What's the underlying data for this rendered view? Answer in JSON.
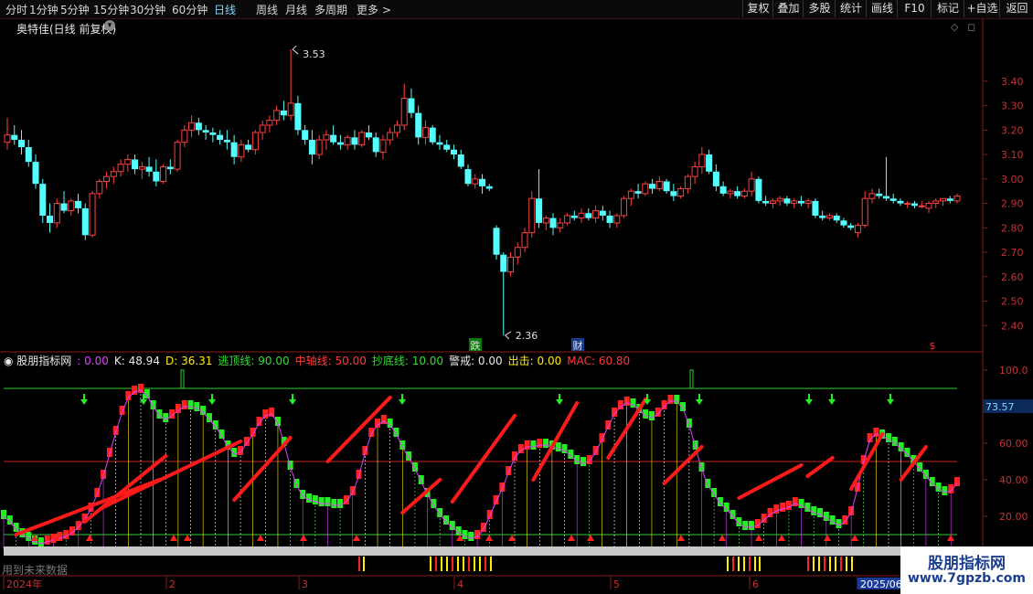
{
  "toolbar": {
    "timeframes": [
      "分时",
      "1分钟",
      "5分钟",
      "15分钟",
      "30分钟",
      "60分钟",
      "日线",
      "周线",
      "月线",
      "多周期",
      "更多 >"
    ],
    "active_timeframe": "日线",
    "right_buttons": [
      "复权",
      "叠加",
      "多股",
      "统计",
      "画线",
      "F10",
      "标记",
      "+自选",
      "返回"
    ]
  },
  "main_panel": {
    "title": "奥特佳(日线 前复权)",
    "price_axis": [
      "3.40",
      "3.30",
      "3.20",
      "3.10",
      "3.00",
      "2.90",
      "2.80",
      "2.70",
      "2.60",
      "2.50",
      "2.40"
    ],
    "high_label": "3.53",
    "low_label": "2.36",
    "markers": [
      "跌",
      "财",
      "$"
    ]
  },
  "indicator_panel": {
    "name": "股朋指标网",
    "values": [
      {
        "label": ": 0.00",
        "color": "#e040ff"
      },
      {
        "label": "K: 48.94",
        "color": "#e8e8e8"
      },
      {
        "label": "D: 36.31",
        "color": "#ffee00"
      },
      {
        "label": "逃顶线: 90.00",
        "color": "#33dd33"
      },
      {
        "label": "中轴线: 50.00",
        "color": "#ff3b3b"
      },
      {
        "label": "抄底线: 10.00",
        "color": "#33dd33"
      },
      {
        "label": "警戒: 0.00",
        "color": "#e8e8e8"
      },
      {
        "label": "出击: 0.00",
        "color": "#ffee00"
      },
      {
        "label": "MAC: 60.80",
        "color": "#ff3b3b"
      }
    ],
    "axis": [
      "100.0",
      "60.00",
      "40.00",
      "20.00"
    ],
    "current_value": "73.57",
    "footer_text": "用到未来数据"
  },
  "date_axis": [
    "2024年",
    "2",
    "3",
    "4",
    "5",
    "6",
    "2025/06"
  ],
  "watermark": {
    "line1": "股朋指标网",
    "line2": "www.7gpzb.com"
  },
  "chart_data": {
    "type": "candlestick",
    "y_range": [
      2.33,
      3.62
    ],
    "ohlc": [
      [
        3.15,
        3.25,
        3.12,
        3.18
      ],
      [
        3.18,
        3.22,
        3.14,
        3.16
      ],
      [
        3.16,
        3.2,
        3.1,
        3.13
      ],
      [
        3.13,
        3.16,
        3.05,
        3.07
      ],
      [
        3.07,
        3.1,
        2.96,
        2.98
      ],
      [
        2.98,
        3.0,
        2.82,
        2.85
      ],
      [
        2.85,
        2.9,
        2.78,
        2.82
      ],
      [
        2.82,
        2.92,
        2.8,
        2.9
      ],
      [
        2.9,
        2.95,
        2.86,
        2.87
      ],
      [
        2.87,
        2.92,
        2.85,
        2.91
      ],
      [
        2.91,
        2.94,
        2.86,
        2.88
      ],
      [
        2.88,
        2.9,
        2.75,
        2.77
      ],
      [
        2.77,
        2.95,
        2.76,
        2.94
      ],
      [
        2.94,
        3.0,
        2.92,
        2.99
      ],
      [
        2.99,
        3.03,
        2.96,
        3.01
      ],
      [
        3.01,
        3.05,
        2.98,
        3.03
      ],
      [
        3.03,
        3.08,
        3.01,
        3.06
      ],
      [
        3.06,
        3.1,
        3.03,
        3.08
      ],
      [
        3.08,
        3.1,
        3.02,
        3.04
      ],
      [
        3.04,
        3.07,
        3.0,
        3.05
      ],
      [
        3.05,
        3.09,
        3.01,
        3.03
      ],
      [
        3.03,
        3.08,
        2.97,
        2.99
      ],
      [
        2.99,
        3.06,
        2.98,
        3.05
      ],
      [
        3.05,
        3.08,
        3.02,
        3.04
      ],
      [
        3.04,
        3.16,
        3.03,
        3.15
      ],
      [
        3.15,
        3.22,
        3.13,
        3.2
      ],
      [
        3.2,
        3.26,
        3.17,
        3.23
      ],
      [
        3.23,
        3.25,
        3.18,
        3.2
      ],
      [
        3.2,
        3.22,
        3.16,
        3.19
      ],
      [
        3.19,
        3.21,
        3.15,
        3.18
      ],
      [
        3.18,
        3.2,
        3.14,
        3.16
      ],
      [
        3.16,
        3.2,
        3.12,
        3.15
      ],
      [
        3.15,
        3.18,
        3.06,
        3.09
      ],
      [
        3.09,
        3.16,
        3.07,
        3.14
      ],
      [
        3.14,
        3.16,
        3.11,
        3.12
      ],
      [
        3.12,
        3.2,
        3.1,
        3.19
      ],
      [
        3.19,
        3.24,
        3.16,
        3.22
      ],
      [
        3.22,
        3.26,
        3.19,
        3.24
      ],
      [
        3.24,
        3.3,
        3.22,
        3.28
      ],
      [
        3.28,
        3.32,
        3.24,
        3.26
      ],
      [
        3.26,
        3.53,
        3.24,
        3.31
      ],
      [
        3.31,
        3.34,
        3.18,
        3.2
      ],
      [
        3.2,
        3.22,
        3.14,
        3.16
      ],
      [
        3.16,
        3.2,
        3.06,
        3.1
      ],
      [
        3.1,
        3.18,
        3.08,
        3.16
      ],
      [
        3.16,
        3.2,
        3.12,
        3.18
      ],
      [
        3.18,
        3.22,
        3.14,
        3.15
      ],
      [
        3.15,
        3.18,
        3.12,
        3.14
      ],
      [
        3.14,
        3.18,
        3.12,
        3.17
      ],
      [
        3.17,
        3.2,
        3.12,
        3.14
      ],
      [
        3.14,
        3.2,
        3.13,
        3.19
      ],
      [
        3.19,
        3.22,
        3.16,
        3.17
      ],
      [
        3.17,
        3.19,
        3.09,
        3.11
      ],
      [
        3.11,
        3.18,
        3.08,
        3.16
      ],
      [
        3.16,
        3.21,
        3.14,
        3.19
      ],
      [
        3.19,
        3.24,
        3.17,
        3.22
      ],
      [
        3.22,
        3.39,
        3.2,
        3.33
      ],
      [
        3.33,
        3.37,
        3.25,
        3.27
      ],
      [
        3.27,
        3.3,
        3.14,
        3.17
      ],
      [
        3.17,
        3.24,
        3.14,
        3.21
      ],
      [
        3.21,
        3.22,
        3.14,
        3.15
      ],
      [
        3.15,
        3.18,
        3.12,
        3.14
      ],
      [
        3.14,
        3.16,
        3.11,
        3.12
      ],
      [
        3.12,
        3.14,
        3.08,
        3.1
      ],
      [
        3.1,
        3.12,
        3.04,
        3.05
      ],
      [
        3.04,
        3.06,
        2.97,
        2.98
      ],
      [
        2.98,
        3.02,
        2.96,
        3.0
      ],
      [
        3.0,
        3.02,
        2.94,
        2.97
      ],
      [
        2.97,
        2.98,
        2.95,
        2.96
      ],
      [
        2.8,
        2.81,
        2.67,
        2.69
      ],
      [
        2.69,
        2.7,
        2.36,
        2.62
      ],
      [
        2.62,
        2.7,
        2.6,
        2.68
      ],
      [
        2.68,
        2.74,
        2.65,
        2.72
      ],
      [
        2.72,
        2.8,
        2.7,
        2.78
      ],
      [
        2.78,
        2.95,
        2.76,
        2.92
      ],
      [
        2.92,
        3.04,
        2.8,
        2.82
      ],
      [
        2.82,
        2.85,
        2.79,
        2.84
      ],
      [
        2.84,
        2.86,
        2.77,
        2.8
      ],
      [
        2.8,
        2.84,
        2.78,
        2.82
      ],
      [
        2.82,
        2.86,
        2.81,
        2.85
      ],
      [
        2.85,
        2.87,
        2.83,
        2.84
      ],
      [
        2.84,
        2.88,
        2.82,
        2.86
      ],
      [
        2.86,
        2.88,
        2.83,
        2.84
      ],
      [
        2.84,
        2.89,
        2.82,
        2.87
      ],
      [
        2.87,
        2.89,
        2.83,
        2.85
      ],
      [
        2.85,
        2.87,
        2.8,
        2.82
      ],
      [
        2.82,
        2.86,
        2.8,
        2.85
      ],
      [
        2.85,
        2.93,
        2.84,
        2.92
      ],
      [
        2.92,
        2.96,
        2.89,
        2.95
      ],
      [
        2.95,
        2.98,
        2.92,
        2.94
      ],
      [
        2.94,
        2.99,
        2.93,
        2.98
      ],
      [
        2.98,
        3.0,
        2.94,
        2.96
      ],
      [
        2.96,
        3.01,
        2.95,
        2.99
      ],
      [
        2.99,
        3.0,
        2.94,
        2.95
      ],
      [
        2.95,
        2.98,
        2.91,
        2.93
      ],
      [
        2.93,
        2.97,
        2.92,
        2.96
      ],
      [
        2.96,
        3.02,
        2.94,
        3.01
      ],
      [
        3.01,
        3.07,
        2.98,
        3.05
      ],
      [
        3.05,
        3.13,
        3.02,
        3.1
      ],
      [
        3.1,
        3.12,
        3.02,
        3.03
      ],
      [
        3.03,
        3.06,
        2.95,
        2.97
      ],
      [
        2.97,
        2.99,
        2.93,
        2.94
      ],
      [
        2.94,
        2.96,
        2.92,
        2.95
      ],
      [
        2.95,
        2.97,
        2.92,
        2.93
      ],
      [
        2.93,
        2.96,
        2.92,
        2.95
      ],
      [
        2.95,
        3.03,
        2.93,
        3.0
      ],
      [
        3.0,
        3.01,
        2.9,
        2.91
      ],
      [
        2.91,
        2.93,
        2.89,
        2.9
      ],
      [
        2.9,
        2.92,
        2.88,
        2.91
      ],
      [
        2.91,
        2.93,
        2.89,
        2.92
      ],
      [
        2.92,
        2.93,
        2.89,
        2.9
      ],
      [
        2.9,
        2.92,
        2.88,
        2.91
      ],
      [
        2.91,
        2.93,
        2.89,
        2.9
      ],
      [
        2.9,
        2.92,
        2.88,
        2.91
      ],
      [
        2.91,
        2.92,
        2.84,
        2.85
      ],
      [
        2.85,
        2.87,
        2.83,
        2.84
      ],
      [
        2.84,
        2.86,
        2.83,
        2.85
      ],
      [
        2.85,
        2.86,
        2.82,
        2.83
      ],
      [
        2.83,
        2.84,
        2.8,
        2.81
      ],
      [
        2.81,
        2.82,
        2.79,
        2.8
      ],
      [
        2.78,
        2.82,
        2.76,
        2.81
      ],
      [
        2.81,
        2.95,
        2.8,
        2.92
      ],
      [
        2.92,
        2.96,
        2.9,
        2.94
      ],
      [
        2.94,
        2.96,
        2.92,
        2.93
      ],
      [
        2.93,
        3.09,
        2.91,
        2.92
      ],
      [
        2.92,
        2.94,
        2.9,
        2.91
      ],
      [
        2.91,
        2.92,
        2.89,
        2.9
      ],
      [
        2.9,
        2.91,
        2.88,
        2.9
      ],
      [
        2.9,
        2.91,
        2.88,
        2.89
      ],
      [
        2.89,
        2.91,
        2.88,
        2.89
      ],
      [
        2.88,
        2.91,
        2.86,
        2.9
      ],
      [
        2.9,
        2.92,
        2.88,
        2.91
      ],
      [
        2.91,
        2.92,
        2.89,
        2.92
      ],
      [
        2.92,
        2.93,
        2.9,
        2.91
      ],
      [
        2.91,
        2.94,
        2.9,
        2.93
      ]
    ],
    "indicator_series": {
      "axis_range": [
        0,
        100
      ],
      "escape_top": 90,
      "middle": 50,
      "bottom": 10,
      "K": [
        20,
        17,
        13,
        10,
        8,
        6,
        5,
        6,
        7,
        8,
        9,
        11,
        14,
        18,
        24,
        32,
        42,
        54,
        66,
        77,
        85,
        88,
        89,
        86,
        80,
        75,
        73,
        75,
        78,
        80,
        80,
        79,
        77,
        73,
        69,
        64,
        58,
        54,
        55,
        60,
        65,
        71,
        75,
        76,
        71,
        60,
        47,
        37,
        31,
        29,
        28,
        27,
        27,
        26,
        26,
        28,
        33,
        42,
        55,
        65,
        70,
        72,
        70,
        65,
        58,
        52,
        46,
        39,
        32,
        26,
        21,
        17,
        14,
        11,
        9,
        8,
        9,
        13,
        20,
        28,
        35,
        44,
        52,
        56,
        58,
        58,
        59,
        59,
        58,
        57,
        56,
        53,
        50,
        49,
        50,
        55,
        62,
        69,
        76,
        80,
        82,
        81,
        78,
        75,
        74,
        76,
        80,
        83,
        83,
        79,
        70,
        58,
        46,
        37,
        32,
        27,
        24,
        20,
        16,
        14,
        14,
        15,
        18,
        21,
        23,
        24,
        25,
        27,
        26,
        24,
        22,
        21,
        19,
        17,
        15,
        17,
        22,
        35,
        50,
        62,
        65,
        64,
        62,
        60,
        57,
        54,
        50,
        46,
        42,
        38,
        35,
        33,
        34,
        38
      ]
    },
    "x_labels": [
      "2024年",
      "2",
      "3",
      "4",
      "5",
      "6",
      "2025/06"
    ]
  }
}
